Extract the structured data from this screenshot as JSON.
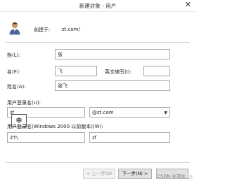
{
  "window": {
    "title": "新建对象 - 用户",
    "close_icon": "close-icon"
  },
  "header": {
    "created_in_label": "创建于:",
    "created_in_value": "zt.com/"
  },
  "form": {
    "last_name_label": "姓(L):",
    "last_name_value": "张",
    "first_name_label": "名(F):",
    "first_name_value": "飞",
    "initials_label": "英文缩写(I):",
    "initials_value": "",
    "full_name_label": "姓名(A):",
    "full_name_value": "张飞",
    "logon_name_label": "用户登录名(U):",
    "logon_name_value": "zf",
    "domain_value": "@zt.com",
    "pre2000_label": "用户登录名(Windows 2000 以前版本)(W):",
    "pre2000_domain_value": "ZT\\",
    "pre2000_name_value": "zf"
  },
  "ime": {
    "mode_label": "中"
  },
  "buttons": {
    "back": "< 上一步(B)",
    "next": "下一步(N) >",
    "cancel": "取消"
  },
  "watermark": "CSDN @流水__L"
}
